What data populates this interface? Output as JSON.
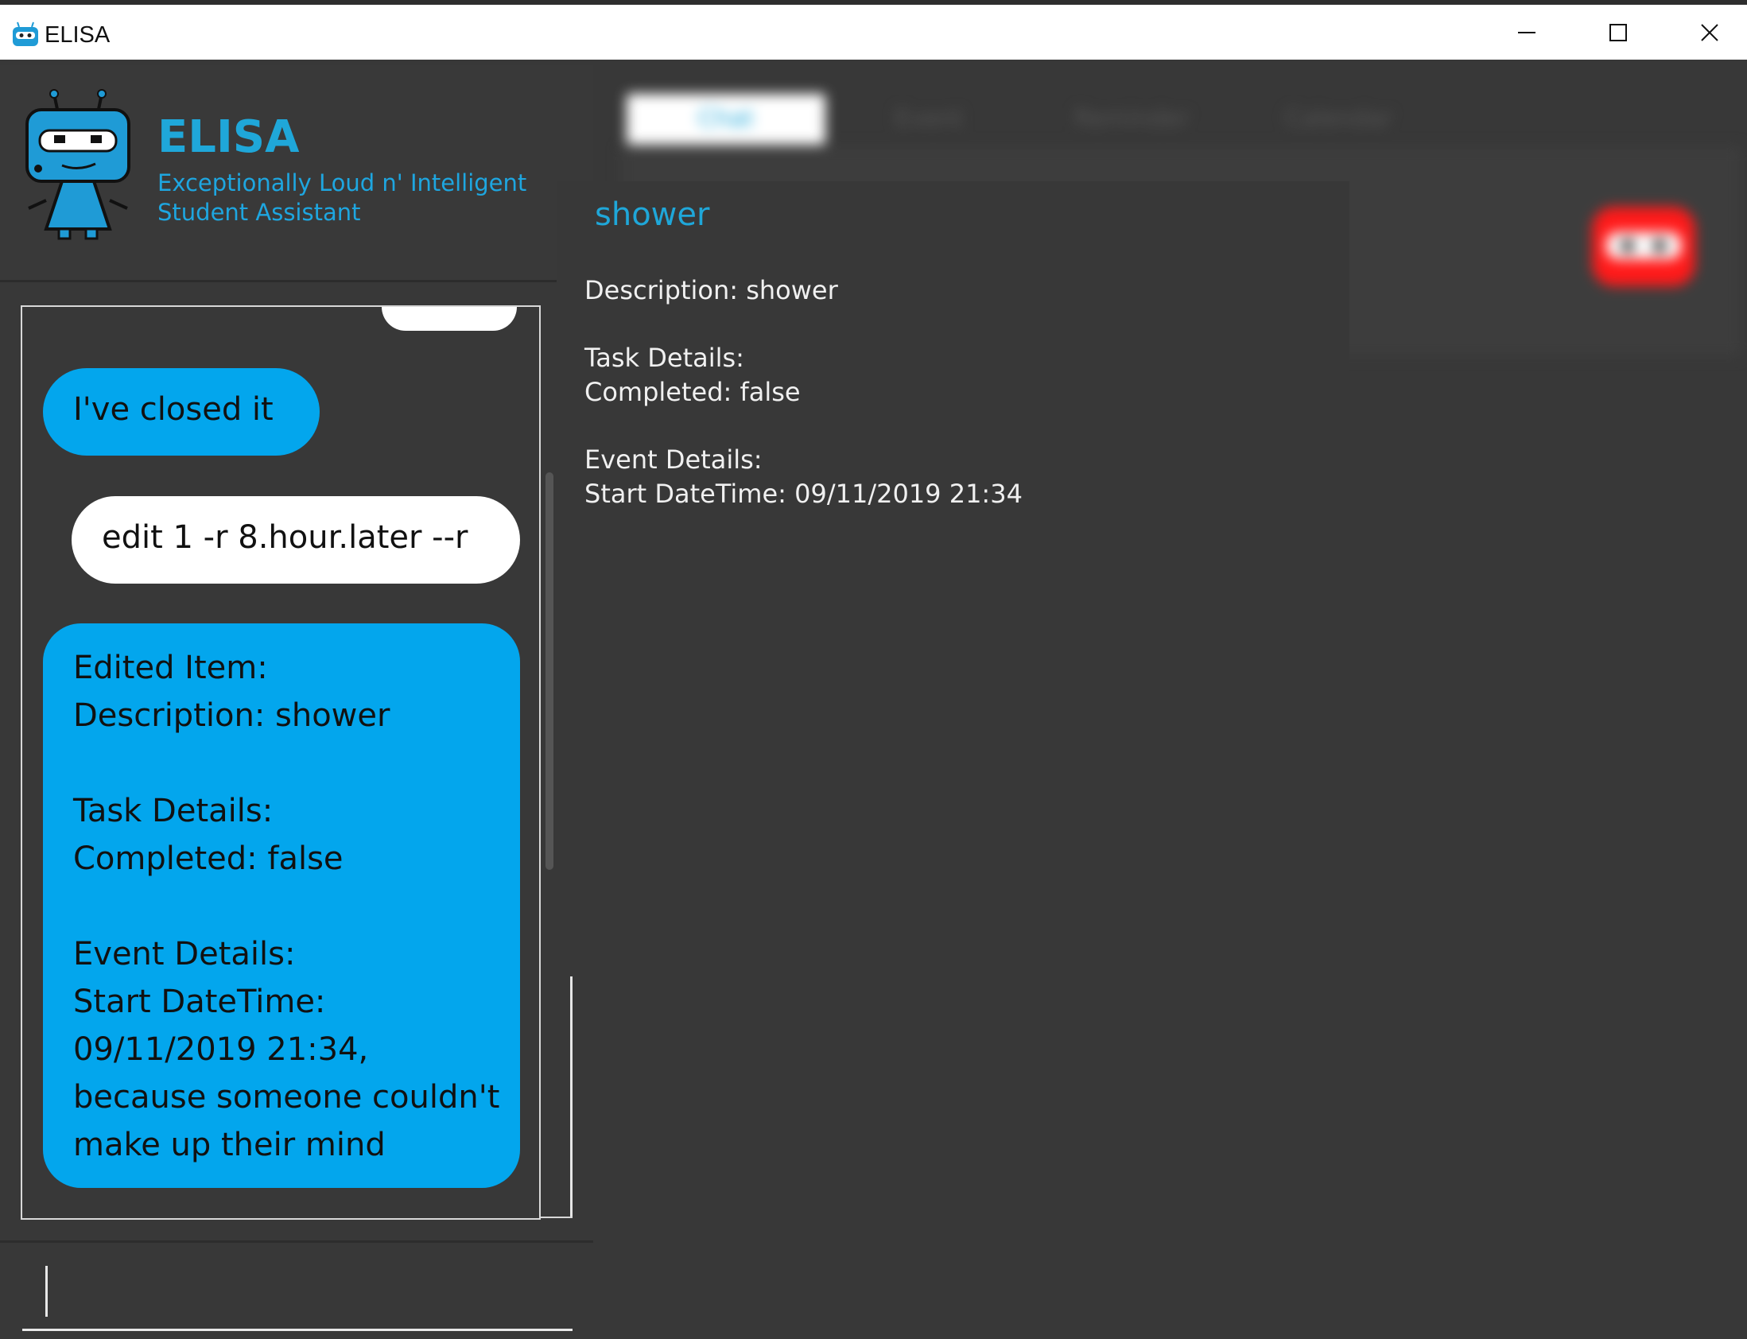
{
  "window": {
    "title": "ELISA",
    "controls": [
      "minimize",
      "maximize",
      "close"
    ]
  },
  "header": {
    "app_name": "ELISA",
    "subtitle": "Exceptionally Loud n' Intelligent Student Assistant"
  },
  "tabs": [
    {
      "label": "Chat",
      "active": true
    },
    {
      "label": "Event"
    },
    {
      "label": "Reminder"
    },
    {
      "label": "Calendar"
    }
  ],
  "chat": {
    "messages": [
      {
        "sender": "bot",
        "text": "I've closed it"
      },
      {
        "sender": "user",
        "text": "edit 1 -r 8.hour.later --r"
      },
      {
        "sender": "bot",
        "text": "Edited Item:\nDescription: shower\n\nTask Details:\nCompleted: false\n\nEvent Details:\nStart DateTime: 09/11/2019 21:34,\nbecause someone couldn't make up their mind"
      }
    ]
  },
  "input": {
    "value": ""
  },
  "detail_popup": {
    "title": "shower",
    "description": "Description: shower",
    "task_heading": "Task Details:",
    "completed": "Completed: false",
    "event_heading": "Event Details:",
    "start": "Start DateTime: 09/11/2019 21:34"
  },
  "colors": {
    "accent": "#1fa7d9",
    "bot_bubble": "#03a6ed",
    "user_bubble": "#ffffff",
    "background": "#383838"
  }
}
